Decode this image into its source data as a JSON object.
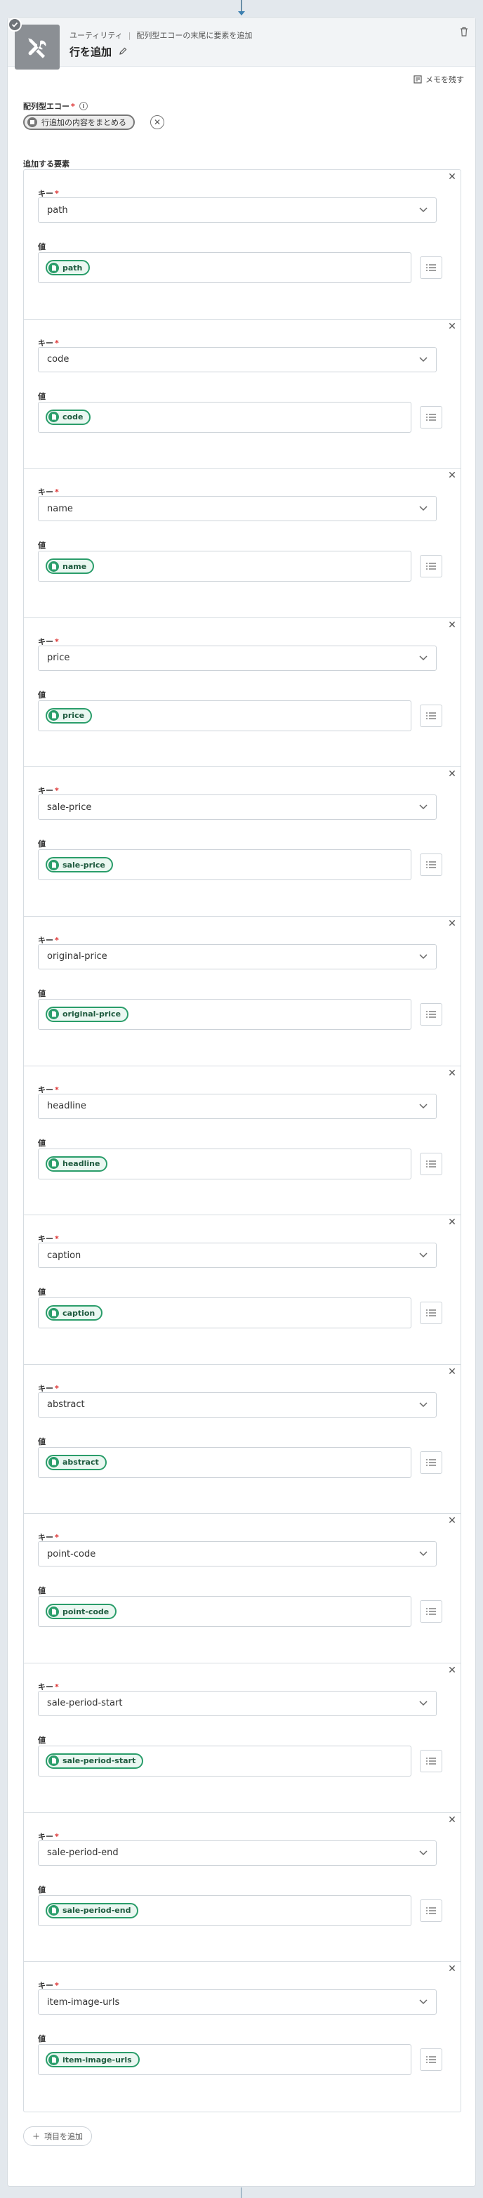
{
  "header": {
    "breadcrumb_category": "ユーティリティ",
    "breadcrumb_action": "配列型エコーの末尾に要素を追加",
    "title": "行を追加"
  },
  "memo_label": "メモを残す",
  "echo": {
    "label": "配列型エコー",
    "chip": "行追加の内容をまとめる"
  },
  "add_section_label": "追加する要素",
  "key_label": "キー",
  "value_label": "値",
  "items": [
    {
      "key": "path",
      "value": "path"
    },
    {
      "key": "code",
      "value": "code"
    },
    {
      "key": "name",
      "value": "name"
    },
    {
      "key": "price",
      "value": "price"
    },
    {
      "key": "sale-price",
      "value": "sale-price"
    },
    {
      "key": "original-price",
      "value": "original-price"
    },
    {
      "key": "headline",
      "value": "headline"
    },
    {
      "key": "caption",
      "value": "caption"
    },
    {
      "key": "abstract",
      "value": "abstract"
    },
    {
      "key": "point-code",
      "value": "point-code"
    },
    {
      "key": "sale-period-start",
      "value": "sale-period-start"
    },
    {
      "key": "sale-period-end",
      "value": "sale-period-end"
    },
    {
      "key": "item-image-urls",
      "value": "item-image-urls"
    }
  ],
  "add_item_button": "項目を追加",
  "colors": {
    "accent_green": "#2a9d6a",
    "header_bg": "#f2f4f6",
    "page_bg": "#e3e8ed"
  }
}
